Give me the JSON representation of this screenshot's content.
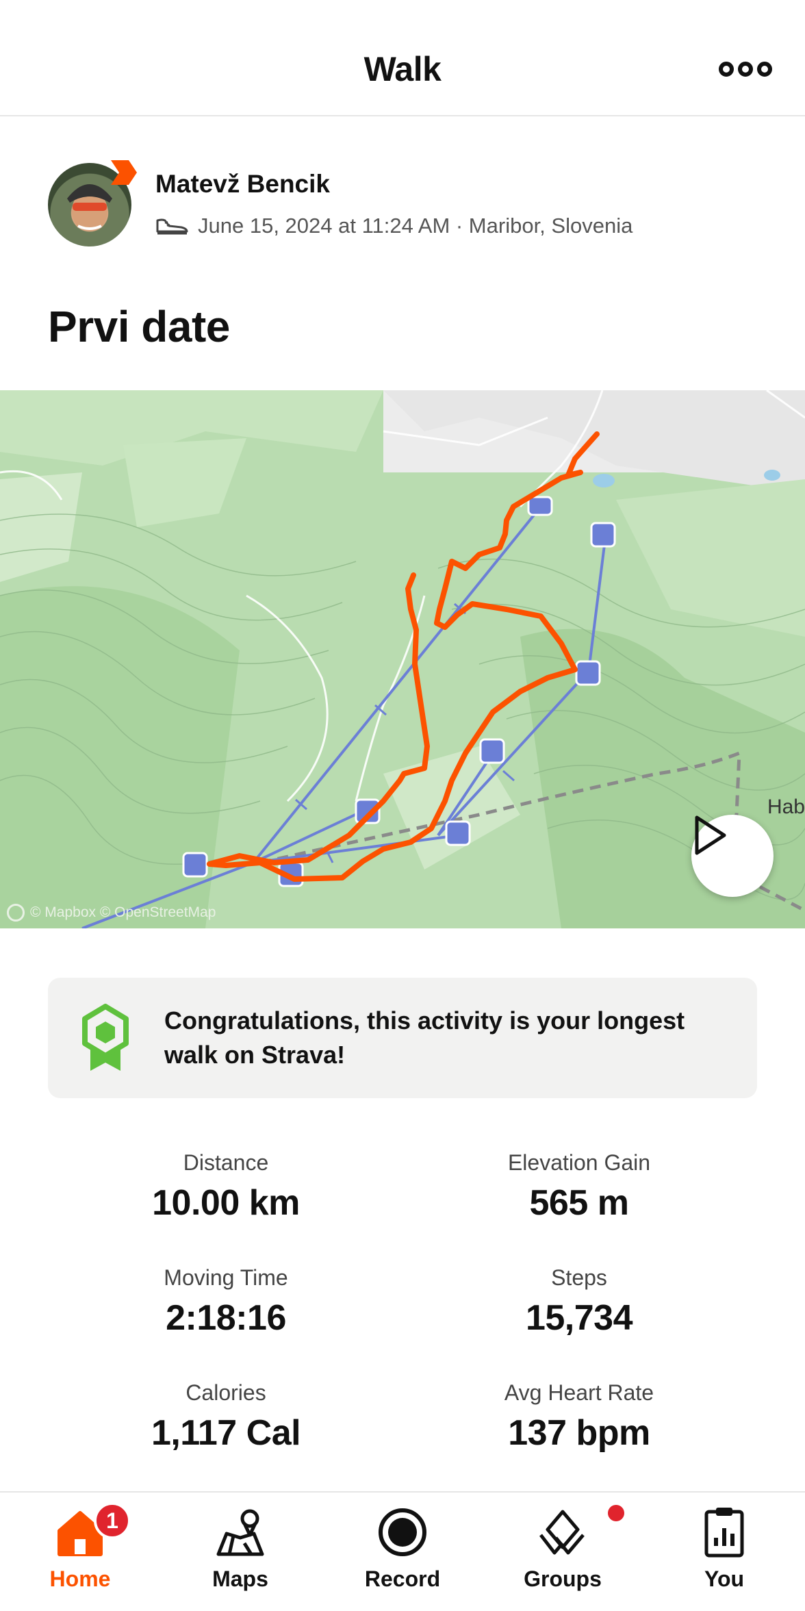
{
  "header": {
    "title": "Walk",
    "more_icon": "more-horizontal-icon"
  },
  "athlete": {
    "name": "Matevž Bencik",
    "activity_icon": "shoe-icon",
    "meta": "June 15, 2024 at 11:24 AM · Maribor, Slovenia"
  },
  "activity": {
    "title": "Prvi date"
  },
  "map": {
    "credit": "© Mapbox © OpenStreetMap",
    "place_label": "Hab",
    "route_color": "#fc5200",
    "lift_color": "#6b7fd6"
  },
  "achievement": {
    "icon": "award-ribbon-icon",
    "text": "Congratulations, this activity is your longest walk on Strava!",
    "icon_color": "#5fc13d"
  },
  "stats": [
    {
      "label": "Distance",
      "value": "10.00 km"
    },
    {
      "label": "Elevation Gain",
      "value": "565 m"
    },
    {
      "label": "Moving Time",
      "value": "2:18:16"
    },
    {
      "label": "Steps",
      "value": "15,734"
    },
    {
      "label": "Calories",
      "value": "1,117 Cal"
    },
    {
      "label": "Avg Heart Rate",
      "value": "137 bpm"
    }
  ],
  "tabs": [
    {
      "label": "Home",
      "icon": "home-icon",
      "badge": "1",
      "active": true
    },
    {
      "label": "Maps",
      "icon": "maps-icon"
    },
    {
      "label": "Record",
      "icon": "record-icon"
    },
    {
      "label": "Groups",
      "icon": "groups-icon",
      "dot": true
    },
    {
      "label": "You",
      "icon": "clipboard-icon"
    }
  ],
  "colors": {
    "accent": "#fc5200",
    "badge": "#e0242d"
  }
}
